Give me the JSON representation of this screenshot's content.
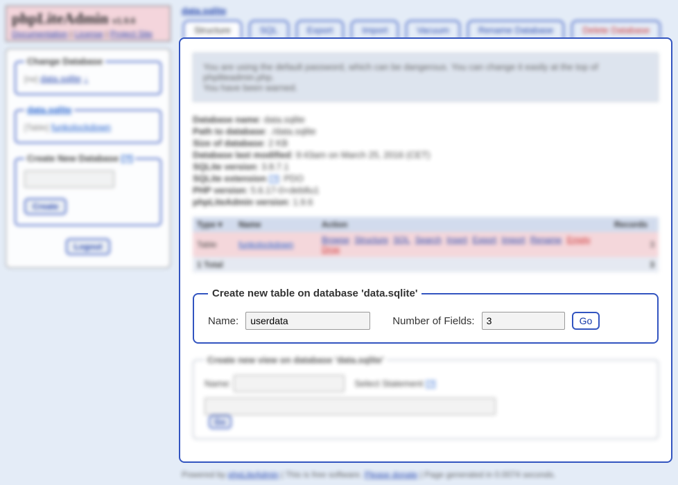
{
  "logo": {
    "title": "phpLiteAdmin",
    "version": "v1.9.6",
    "links": [
      "Documentation",
      "License",
      "Project Site"
    ]
  },
  "sidebar": {
    "changedb": {
      "legend": "Change Database",
      "rw_label": "[rw]",
      "db_name": "data.sqlite",
      "arrow": "↓"
    },
    "dbbox": {
      "legend": "data.sqlite",
      "table_prefix": "[Table]",
      "table_name": "funkolockdown"
    },
    "createdb": {
      "legend": "Create New Database",
      "help": "[?]",
      "button": "Create"
    },
    "logout": "Logout"
  },
  "breadcrumb": "data.sqlite",
  "tabs": [
    {
      "label": "Structure",
      "active": true
    },
    {
      "label": "SQL"
    },
    {
      "label": "Export"
    },
    {
      "label": "Import"
    },
    {
      "label": "Vacuum"
    },
    {
      "label": "Rename Database"
    },
    {
      "label": "Delete Database",
      "danger": true
    }
  ],
  "warning": {
    "line1": "You are using the default password, which can be dangerous. You can change it easily at the top of phpliteadmin.php.",
    "line2": "You have been warned."
  },
  "dbinfo": [
    {
      "k": "Database name",
      "v": "data.sqlite"
    },
    {
      "k": "Path to database",
      "v": "./data.sqlite"
    },
    {
      "k": "Size of database",
      "v": "2 KB"
    },
    {
      "k": "Database last modified",
      "v": "9:43am on March 25, 2016 (CET)"
    },
    {
      "k": "SQLite version",
      "v": "3.8.7.1"
    },
    {
      "k": "SQLite extension",
      "v": "PDO",
      "help": "[?]"
    },
    {
      "k": "PHP version",
      "v": "5.6.17-0+deb8u1"
    },
    {
      "k": "phpLiteAdmin version",
      "v": "1.9.6"
    }
  ],
  "grid": {
    "headers": {
      "type": "Type",
      "name": "Name",
      "action": "Action",
      "records": "Records"
    },
    "rows": [
      {
        "type": "Table",
        "name": "funkolockdown",
        "records": "3",
        "actions": [
          "Browse",
          "Structure",
          "SQL",
          "Search",
          "Insert",
          "Export",
          "Import",
          "Rename"
        ],
        "danger": [
          "Empty",
          "Drop"
        ]
      }
    ],
    "total_label": "1 Total",
    "total_records": "3"
  },
  "create_table": {
    "legend": "Create new table on database 'data.sqlite'",
    "name_label": "Name:",
    "name_value": "userdata",
    "num_label": "Number of Fields:",
    "num_value": "3",
    "go": "Go"
  },
  "create_view": {
    "legend": "Create new view on database 'data.sqlite'",
    "name_label": "Name:",
    "select_label": "Select Statement",
    "help": "[?]",
    "go": "Go"
  },
  "footer": {
    "powered": "Powered by",
    "pla": "phpLiteAdmin",
    "free": "| This is free software.",
    "donate": "Please donate",
    "gen": "| Page generated in 0.0074 seconds."
  }
}
